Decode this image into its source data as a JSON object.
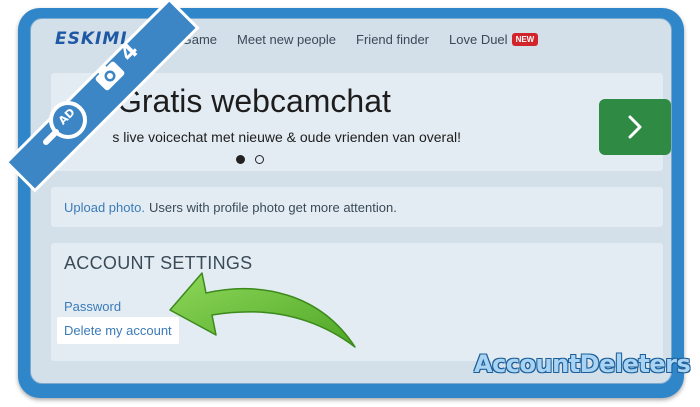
{
  "site": {
    "logo_text": "ESKIMI"
  },
  "nav": {
    "items": [
      {
        "label": "Game"
      },
      {
        "label": "Meet new people"
      },
      {
        "label": "Friend finder"
      },
      {
        "label": "Love Duel",
        "badge": "NEW"
      }
    ]
  },
  "banner": {
    "title": "Gratis webcamchat",
    "subtitle": "s live voicechat met nieuwe & oude vrienden van overal!",
    "next_icon": "chevron-right-icon",
    "carousel": {
      "count": 2,
      "active_index": 0
    }
  },
  "notice": {
    "link_label": "Upload photo.",
    "text": "Users with profile photo get more attention."
  },
  "settings": {
    "title": "ACCOUNT SETTINGS",
    "links": {
      "password": "Password",
      "delete_account": "Delete my account"
    }
  },
  "overlay": {
    "step_number": "4",
    "ribbon_icon": "camera-icon",
    "corner_icon": "magnifier-icon",
    "corner_text": "AD",
    "watermark": "AccountDeleters",
    "colors": {
      "ribbon": "#3d86c6",
      "arrow": "#6cc23a",
      "frame": "#2f86c9",
      "next_button": "#2f8a43"
    }
  }
}
